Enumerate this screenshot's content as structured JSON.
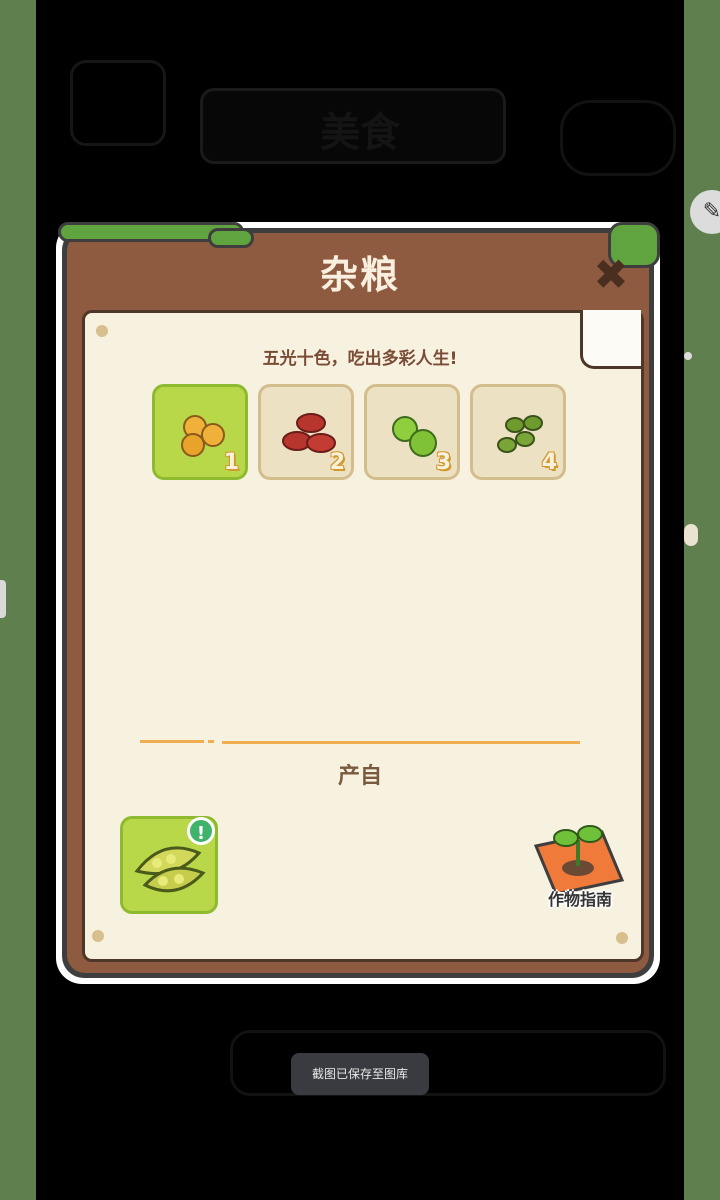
{
  "dialog": {
    "title": "杂粮",
    "subtitle": "五光十色，吃出多彩人生!",
    "variants": [
      {
        "number": "1",
        "icon": "yellow-beans-icon",
        "selected": true
      },
      {
        "number": "2",
        "icon": "red-beans-icon",
        "selected": false
      },
      {
        "number": "3",
        "icon": "green-peas-icon",
        "selected": false
      },
      {
        "number": "4",
        "icon": "mung-beans-icon",
        "selected": false
      }
    ],
    "source_label": "产自",
    "source_item": {
      "icon": "soybean-pod-icon",
      "badge": "!"
    },
    "guide_label": "作物指南"
  },
  "background": {
    "title": "美食"
  },
  "toast": "截图已保存至图库",
  "colors": {
    "wood": "#8e5b41",
    "paper": "#f7f2e0",
    "selected_tile": "#b8d84a",
    "divider": "#f0ad52",
    "side_strip": "#5f7f4f"
  }
}
